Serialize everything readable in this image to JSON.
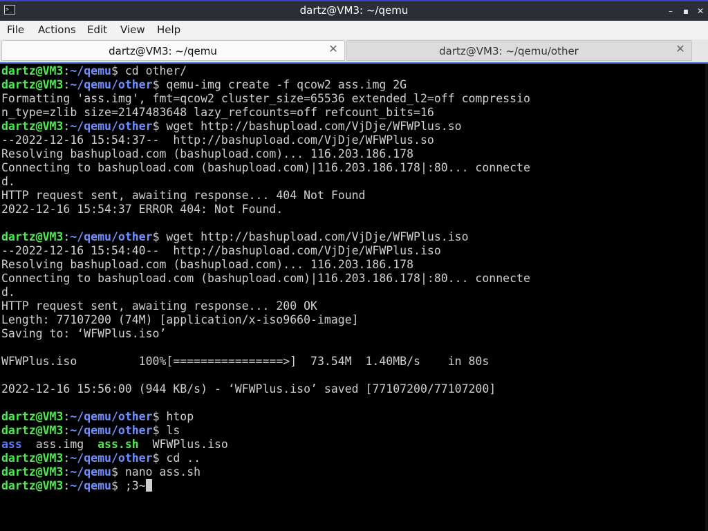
{
  "window": {
    "title": "dartz@VM3: ~/qemu",
    "app_icon_text": ">_",
    "minimize_glyph": "–",
    "maximize_glyph": "▪",
    "close_glyph": "✕"
  },
  "menu": [
    "File",
    "Actions",
    "Edit",
    "View",
    "Help"
  ],
  "tabs": [
    {
      "label": "dartz@VM3: ~/qemu",
      "active": true,
      "close_glyph": "✕"
    },
    {
      "label": "dartz@VM3: ~/qemu/other",
      "active": false,
      "close_glyph": "✕"
    }
  ],
  "terminal": {
    "prompt_user": "dartz@VM3",
    "prompt_colon": ":",
    "prompt_dollar": "$",
    "lines": [
      {
        "type": "prompt",
        "path": "~/qemu",
        "cmd": " cd other/"
      },
      {
        "type": "prompt",
        "path": "~/qemu/other",
        "cmd": " qemu-img create -f qcow2 ass.img 2G"
      },
      {
        "type": "text",
        "text": "Formatting 'ass.img', fmt=qcow2 cluster_size=65536 extended_l2=off compressio"
      },
      {
        "type": "text",
        "text": "n_type=zlib size=2147483648 lazy_refcounts=off refcount_bits=16"
      },
      {
        "type": "prompt",
        "path": "~/qemu/other",
        "cmd": " wget http://bashupload.com/VjDje/WFWPlus.so"
      },
      {
        "type": "text",
        "text": "--2022-12-16 15:54:37--  http://bashupload.com/VjDje/WFWPlus.so"
      },
      {
        "type": "text",
        "text": "Resolving bashupload.com (bashupload.com)... 116.203.186.178"
      },
      {
        "type": "text",
        "text": "Connecting to bashupload.com (bashupload.com)|116.203.186.178|:80... connecte"
      },
      {
        "type": "text",
        "text": "d."
      },
      {
        "type": "text",
        "text": "HTTP request sent, awaiting response... 404 Not Found"
      },
      {
        "type": "text",
        "text": "2022-12-16 15:54:37 ERROR 404: Not Found."
      },
      {
        "type": "text",
        "text": ""
      },
      {
        "type": "prompt",
        "path": "~/qemu/other",
        "cmd": " wget http://bashupload.com/VjDje/WFWPlus.iso"
      },
      {
        "type": "text",
        "text": "--2022-12-16 15:54:40--  http://bashupload.com/VjDje/WFWPlus.iso"
      },
      {
        "type": "text",
        "text": "Resolving bashupload.com (bashupload.com)... 116.203.186.178"
      },
      {
        "type": "text",
        "text": "Connecting to bashupload.com (bashupload.com)|116.203.186.178|:80... connecte"
      },
      {
        "type": "text",
        "text": "d."
      },
      {
        "type": "text",
        "text": "HTTP request sent, awaiting response... 200 OK"
      },
      {
        "type": "text",
        "text": "Length: 77107200 (74M) [application/x-iso9660-image]"
      },
      {
        "type": "text",
        "text": "Saving to: ‘WFWPlus.iso’"
      },
      {
        "type": "text",
        "text": ""
      },
      {
        "type": "text",
        "text": "WFWPlus.iso         100%[================>]  73.54M  1.40MB/s    in 80s"
      },
      {
        "type": "text",
        "text": ""
      },
      {
        "type": "text",
        "text": "2022-12-16 15:56:00 (944 KB/s) - ‘WFWPlus.iso’ saved [77107200/77107200]"
      },
      {
        "type": "text",
        "text": ""
      },
      {
        "type": "prompt",
        "path": "~/qemu/other",
        "cmd": " htop"
      },
      {
        "type": "prompt",
        "path": "~/qemu/other",
        "cmd": " ls"
      },
      {
        "type": "ls",
        "items": [
          {
            "name": "ass",
            "kind": "dir",
            "sep": "  "
          },
          {
            "name": "ass.img",
            "kind": "file",
            "sep": "  "
          },
          {
            "name": "ass.sh",
            "kind": "exe",
            "sep": "  "
          },
          {
            "name": "WFWPlus.iso",
            "kind": "file",
            "sep": ""
          }
        ]
      },
      {
        "type": "prompt",
        "path": "~/qemu/other",
        "cmd": " cd .."
      },
      {
        "type": "prompt",
        "path": "~/qemu",
        "cmd": " nano ass.sh"
      },
      {
        "type": "prompt",
        "path": "~/qemu",
        "cmd": " ;3~",
        "cursor": true
      }
    ]
  },
  "colors": {
    "prompt_user": "#4fe84f",
    "prompt_path": "#6e8fff",
    "text": "#cfcfcf",
    "background": "#000000",
    "title_bar": "#2b2e37"
  }
}
